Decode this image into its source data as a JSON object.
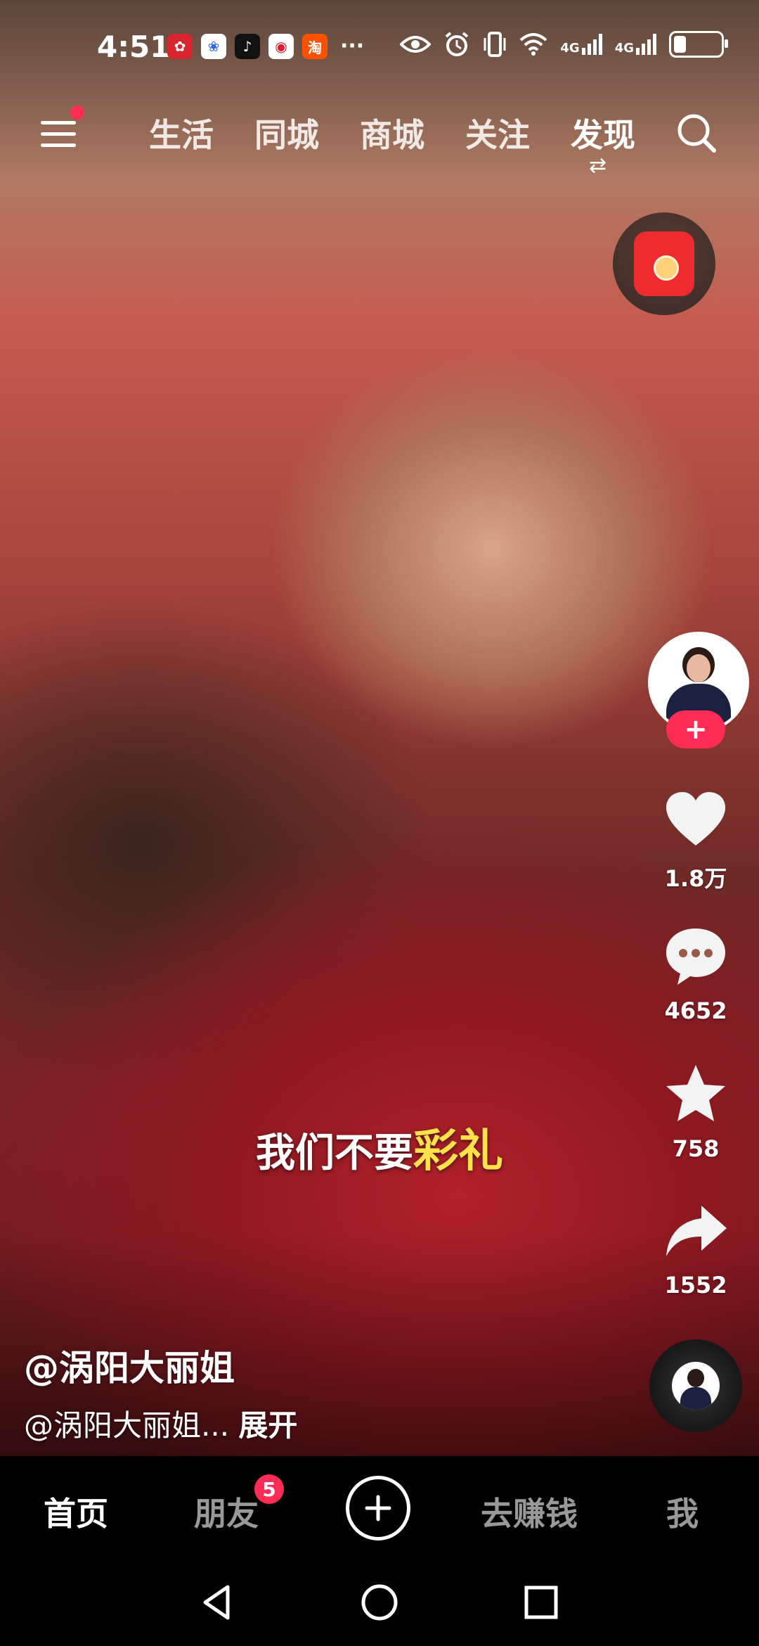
{
  "status_bar": {
    "time": "4:51",
    "notification_apps": [
      "huawei-app-icon",
      "baidu-app-icon",
      "tiktok-app-icon",
      "weibo-app-icon",
      "taobao-app-icon"
    ],
    "overflow": "···",
    "network_1": "4G",
    "network_2": "4G",
    "battery_level": 0.3
  },
  "top_nav": {
    "tabs": [
      "生活",
      "同城",
      "商城",
      "关注",
      "发现"
    ],
    "active_tab": "发现"
  },
  "video": {
    "subtitle_prefix": "我们不要",
    "subtitle_highlight": "彩礼"
  },
  "actions": {
    "likes": "1.8万",
    "comments": "4652",
    "favorites": "758",
    "shares": "1552"
  },
  "caption": {
    "author": "@涡阳大丽姐",
    "description": "@涡阳大丽姐...",
    "expand": "展开"
  },
  "bottom_tabs": {
    "home": "首页",
    "friends": "朋友",
    "friends_badge": "5",
    "earn": "去赚钱",
    "me": "我"
  },
  "colors": {
    "accent": "#ff2d55",
    "subtitle_highlight": "#ffe24a"
  }
}
